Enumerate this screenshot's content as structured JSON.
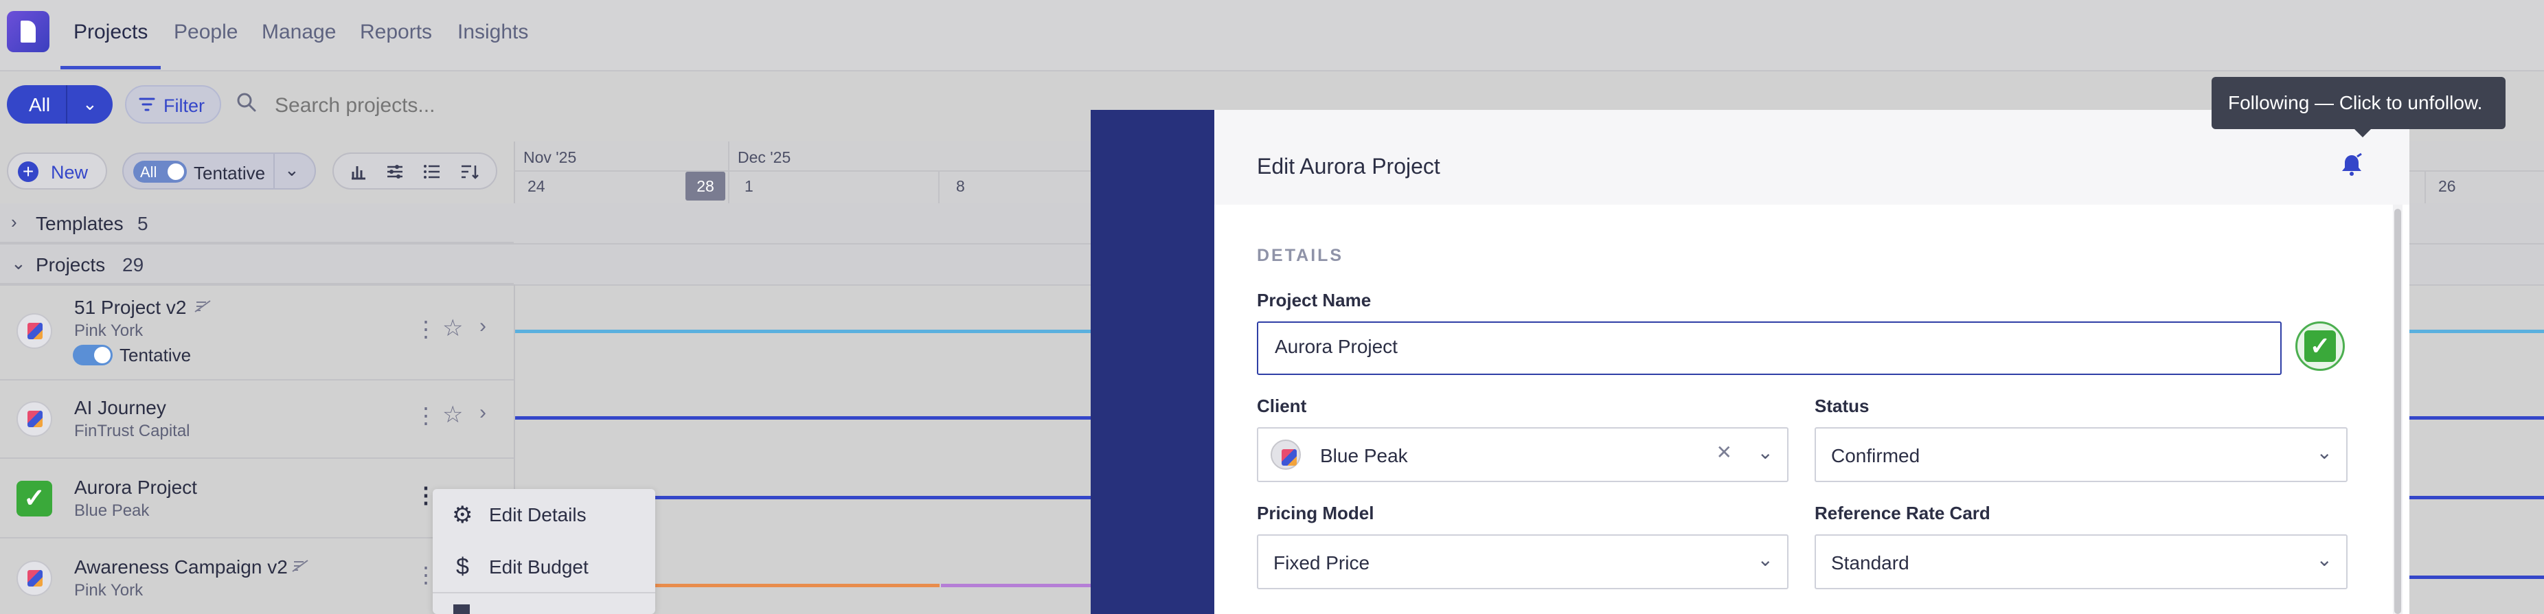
{
  "nav": {
    "items": [
      "Projects",
      "People",
      "Manage",
      "Reports",
      "Insights"
    ],
    "active": "Projects"
  },
  "toolbar": {
    "all_label": "All",
    "filter_label": "Filter",
    "search_placeholder": "Search projects...",
    "new_label": "New",
    "all_toggle": "All",
    "tentative_label": "Tentative"
  },
  "timeline": {
    "months": [
      "Nov '25",
      "Dec '25"
    ],
    "days": [
      "24",
      "28",
      "1",
      "8",
      "26"
    ],
    "today": "28"
  },
  "sections": {
    "templates": {
      "label": "Templates",
      "count": "5"
    },
    "projects": {
      "label": "Projects",
      "count": "29"
    }
  },
  "projects": [
    {
      "name": "51 Project v2",
      "client": "Pink York",
      "tentative": "Tentative",
      "bar_color": "#5ab0de"
    },
    {
      "name": "AI Journey",
      "client": "FinTrust Capital",
      "bar_color": "#3446c9"
    },
    {
      "name": "Aurora Project",
      "client": "Blue Peak",
      "bar_color": "#3446c9"
    },
    {
      "name": "Awareness Campaign v2",
      "client": "Pink York",
      "bar_color": "#3446c9"
    }
  ],
  "context_menu": {
    "items": [
      "Edit Details",
      "Edit Budget"
    ]
  },
  "modal": {
    "title": "Edit Aurora Project",
    "section": "DETAILS",
    "project_name_label": "Project Name",
    "project_name_value": "Aurora Project",
    "client_label": "Client",
    "client_value": "Blue Peak",
    "status_label": "Status",
    "status_value": "Confirmed",
    "pricing_label": "Pricing Model",
    "pricing_value": "Fixed Price",
    "ratecard_label": "Reference Rate Card",
    "ratecard_value": "Standard"
  },
  "tooltip": "Following — Click to unfollow.",
  "colors": {
    "accent": "#3446c9",
    "modal_side": "#27317c",
    "check": "#3aa93a"
  }
}
